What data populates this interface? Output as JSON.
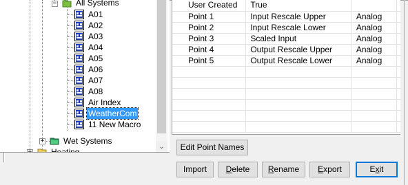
{
  "tree": {
    "nodes": [
      {
        "label": "All Systems",
        "icon": "folder-systems-icon"
      },
      {
        "label": "A01",
        "icon": "device-icon"
      },
      {
        "label": "A02",
        "icon": "device-icon"
      },
      {
        "label": "A03",
        "icon": "device-icon"
      },
      {
        "label": "A04",
        "icon": "device-icon"
      },
      {
        "label": "A05",
        "icon": "device-icon"
      },
      {
        "label": "A06",
        "icon": "device-icon"
      },
      {
        "label": "A07",
        "icon": "device-icon"
      },
      {
        "label": "A08",
        "icon": "device-icon"
      },
      {
        "label": "Air Index",
        "icon": "device-icon"
      },
      {
        "label": "WeatherCom",
        "icon": "device-icon",
        "selected": true
      },
      {
        "label": "11 New Macro",
        "icon": "device-icon"
      },
      {
        "label": "Wet Systems",
        "icon": "folder-green-icon"
      },
      {
        "label": "Heating",
        "icon": "folder-yellow-icon"
      }
    ],
    "expanders": [
      "−",
      "+",
      "+"
    ]
  },
  "list": {
    "rows": [
      [
        "User Created",
        "True",
        ""
      ],
      [
        "Point 1",
        "Input Rescale Upper",
        "Analog"
      ],
      [
        "Point 2",
        "Input Rescale Lower",
        "Analog"
      ],
      [
        "Point 3",
        "Scaled Input",
        "Analog"
      ],
      [
        "Point 4",
        "Output Rescale Upper",
        "Analog"
      ],
      [
        "Point 5",
        "Output Rescale Lower",
        "Analog"
      ]
    ]
  },
  "scrollbar": {
    "down_arrow": "⌄"
  },
  "buttons": {
    "edit_point_names": "Edit Point Names",
    "import": "Import",
    "delete_pre": "",
    "delete_key": "D",
    "delete_rest": "elete",
    "rename_key": "R",
    "rename_rest": "ename",
    "export_key": "E",
    "export_rest": "xport",
    "exit_pre": "E",
    "exit_key": "x",
    "exit_rest": "it"
  },
  "colors": {
    "selection": "#3399ff",
    "default_button_border": "#0078d7"
  }
}
